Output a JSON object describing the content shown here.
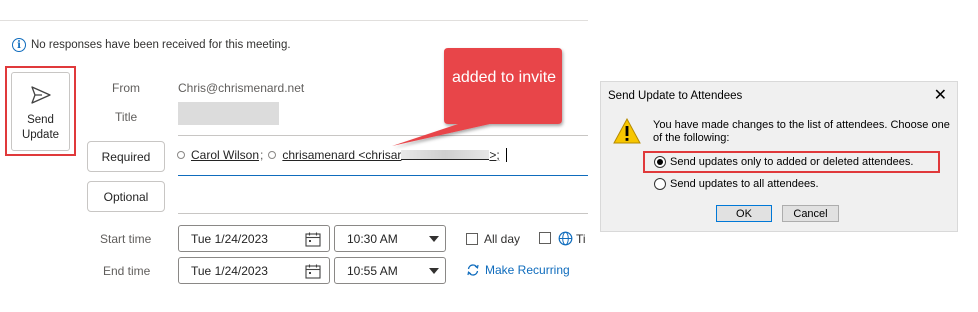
{
  "notice": {
    "text": "No responses have been received for this meeting."
  },
  "toolbar": {
    "send_label": "Send Update"
  },
  "form": {
    "from_label": "From",
    "from_value": "Chris@chrismenard.net",
    "title_label": "Title",
    "required_label": "Required",
    "optional_label": "Optional",
    "attendees": [
      {
        "name": "Carol Wilson"
      },
      {
        "name": "chrisamenard <chrisar"
      }
    ],
    "attendee_tail": ">;",
    "start_label": "Start time",
    "end_label": "End time",
    "start_date": "Tue 1/24/2023",
    "start_time": "10:30 AM",
    "end_date": "Tue 1/24/2023",
    "end_time": "10:55 AM",
    "all_day_label": "All day",
    "tz_fragment": "Ti",
    "make_recurring_label": "Make Recurring"
  },
  "callout": {
    "text": "added to invite"
  },
  "dialog": {
    "title": "Send Update to Attendees",
    "message": "You have made changes to the list of attendees. Choose one of the following:",
    "options": [
      {
        "label": "Send updates only to added or deleted attendees.",
        "selected": true
      },
      {
        "label": "Send updates to all attendees.",
        "selected": false
      }
    ],
    "ok_label": "OK",
    "cancel_label": "Cancel"
  },
  "colors": {
    "accent": "#0f6cbd",
    "highlight": "#e0393b",
    "callout": "#e8454a"
  }
}
